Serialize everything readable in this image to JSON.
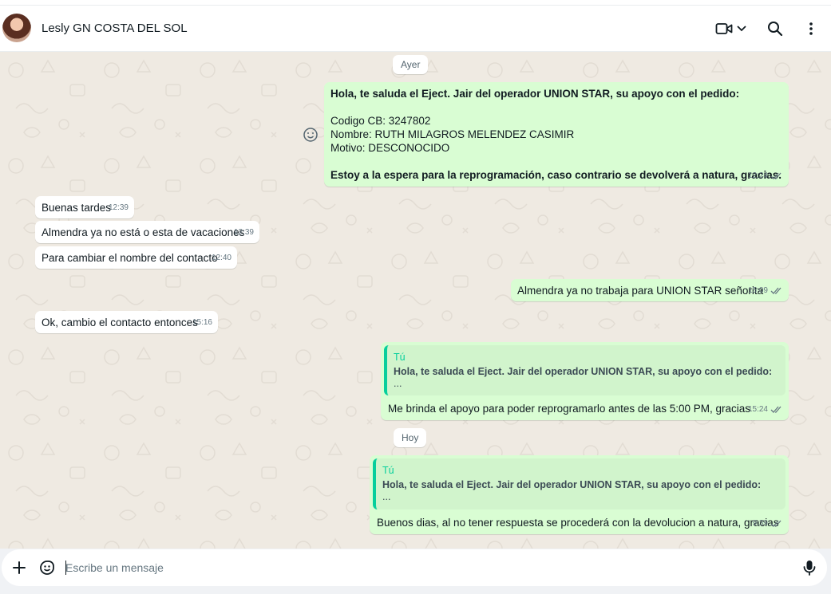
{
  "header": {
    "contact_name": "Lesly GN COSTA DEL SOL",
    "icons": [
      "avatar",
      "video-call-icon",
      "chevron-down-icon",
      "search-icon",
      "menu-dots-icon"
    ]
  },
  "chips": {
    "ayer": "Ayer",
    "hoy": "Hoy"
  },
  "messages": {
    "m1": {
      "line1": "Hola, te saluda el Eject. Jair del operador UNION STAR, su apoyo con el pedido:",
      "line2": "Codigo CB: 3247802",
      "line3": "Nombre: RUTH MILAGROS MELENDEZ CASIMIR",
      "line4": "Motivo: DESCONOCIDO",
      "line5": "Estoy a la espera para la reprogramación, caso contrario se devolverá a natura, gracias.",
      "time": "12:24"
    },
    "m2": {
      "text": "Buenas tardes",
      "time": "12:39"
    },
    "m3": {
      "text": "Almendra ya no está o esta de vacaciones",
      "time": "12:39"
    },
    "m4": {
      "text": "Para cambiar el nombre del contacto",
      "time": "12:40"
    },
    "m5": {
      "text": "Almendra ya no trabaja para UNION STAR señorita",
      "time": "15:09"
    },
    "m6": {
      "text": "Ok, cambio el contacto entonces",
      "time": "15:16"
    },
    "m7": {
      "quote_author": "Tú",
      "quote_text": "Hola, te saluda el Eject. Jair del operador UNION STAR, su apoyo con el pedido:",
      "quote_ellipsis": "...",
      "text": "Me brinda el apoyo para poder reprogramarlo antes de las 5:00 PM, gracias",
      "time": "15:24"
    },
    "m8": {
      "quote_author": "Tú",
      "quote_text": "Hola, te saluda el Eject. Jair del operador UNION STAR, su apoyo con el pedido:",
      "quote_ellipsis": "...",
      "text": "Buenos dias, al no tener respuesta se procederá con la devolucion a natura, gracias",
      "time": "9:39"
    }
  },
  "composer": {
    "placeholder": "Escribe un mensaje",
    "icons": [
      "plus-icon",
      "sticker-icon",
      "microphone-icon"
    ]
  },
  "colors": {
    "chat_bg": "#efeae2",
    "outgoing": "#d9fdd3",
    "incoming": "#ffffff",
    "accent": "#06cf9c",
    "read_ticks": "#667781"
  }
}
